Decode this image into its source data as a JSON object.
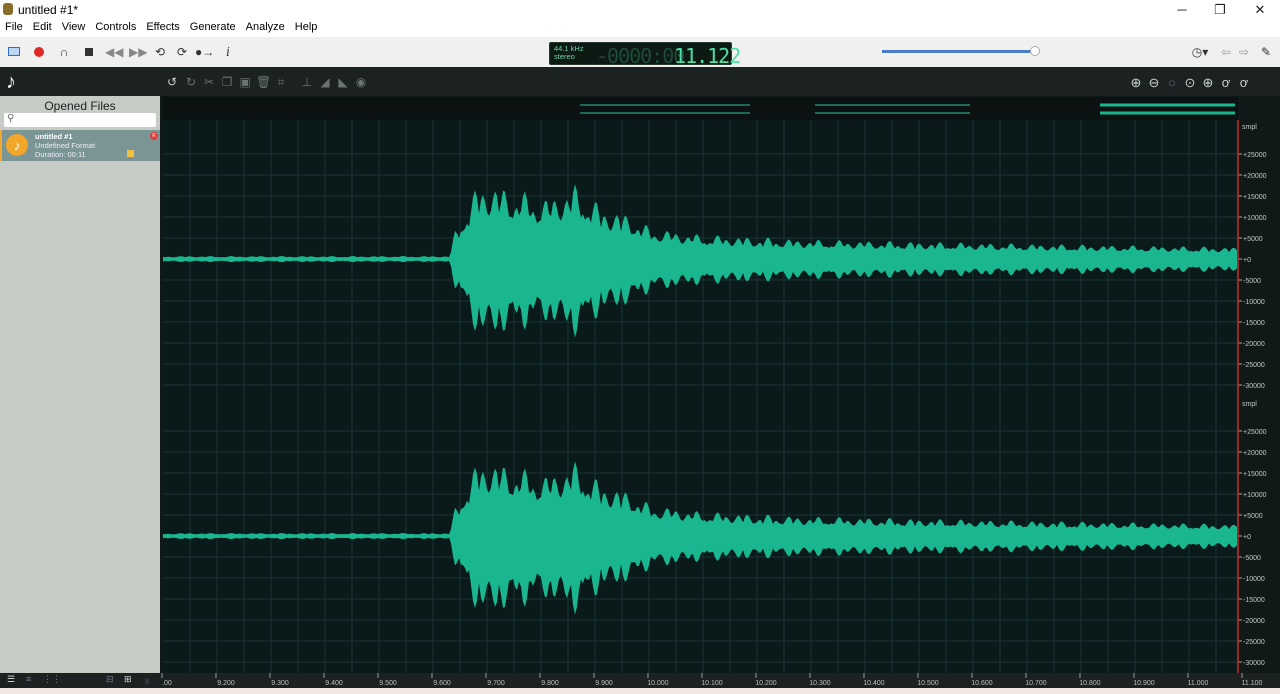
{
  "window": {
    "title": "untitled #1*",
    "minimize": "─",
    "restore": "❐",
    "close": "✕"
  },
  "menu": [
    "File",
    "Edit",
    "View",
    "Controls",
    "Effects",
    "Generate",
    "Analyze",
    "Help"
  ],
  "counter": {
    "rate": "44.1 kHz",
    "channels": "stereo",
    "dim": "-0000:00",
    "value": "11.122"
  },
  "zoom_slider": {
    "value": 0.95
  },
  "sidebar": {
    "title": "Opened Files",
    "search_placeholder": "",
    "file": {
      "name": "untitled #1",
      "format": "Undefined Format",
      "duration": "Duration: 00:11",
      "badge": "R"
    }
  },
  "amplitude_axis": {
    "unit": "smpl",
    "labels": [
      "+25000",
      "+20000",
      "+15000",
      "+10000",
      "+5000",
      "+0",
      "-5000",
      "-10000",
      "-15000",
      "-20000",
      "-25000",
      "-30000"
    ]
  },
  "time_axis": {
    "labels": [
      ".00",
      "9.200",
      "9.300",
      "9.400",
      "9.500",
      "9.600",
      "9.700",
      "9.800",
      "9.900",
      "10.000",
      "10.100",
      "10.200",
      "10.300",
      "10.400",
      "10.500",
      "10.600",
      "10.700",
      "10.800",
      "10.900",
      "11.000",
      "11.100"
    ]
  },
  "colors": {
    "waveform": "#19b690",
    "background": "#0a1414",
    "cursor": "#c83030"
  }
}
